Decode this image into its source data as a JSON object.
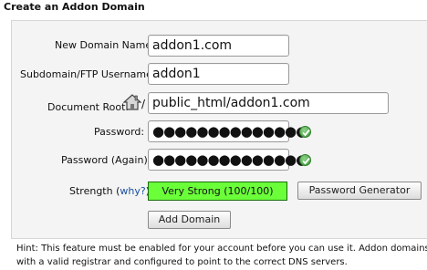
{
  "heading": "Create an Addon Domain",
  "form": {
    "new_domain_label": "New Domain Name:",
    "new_domain_value": "addon1.com",
    "subdomain_label": "Subdomain/FTP Username:",
    "subdomain_value": "addon1",
    "docroot_label": "Document Root:",
    "docroot_prefix": "/",
    "docroot_value": "public_html/addon1.com",
    "password_label": "Password:",
    "password_value": "●●●●●●●●●●●●●●",
    "password_again_label": "Password (Again):",
    "password_again_value": "●●●●●●●●●●●●●●",
    "strength_label": "Strength",
    "strength_open_paren": "(",
    "strength_why_link": "why?",
    "strength_close": "):",
    "strength_value": "Very Strong (100/100)",
    "password_generator_button": "Password Generator",
    "add_domain_button": "Add Domain"
  },
  "hint": {
    "line1": "Hint: This feature must be enabled for your account before you can use it. Addon domains wil",
    "line2": "with a valid registrar and configured to point to the correct DNS servers."
  },
  "colors": {
    "strength_bg": "#6bff3a",
    "check_green": "#3a9a35",
    "link": "#1a4fa0"
  }
}
